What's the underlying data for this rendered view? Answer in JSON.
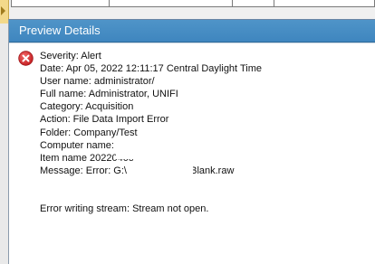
{
  "panel": {
    "title": "Preview  Details"
  },
  "details": {
    "severity": "Severity: Alert",
    "date": "Date: Apr 05, 2022 12:11:17 Central Daylight Time",
    "user_name": "User name: administrator/",
    "full_name": "Full name: Administrator, UNIFI",
    "category": "Category: Acquisition",
    "action": "Action: File Data Import Error",
    "folder": "Folder: Company/Test",
    "computer_name": "Computer name: \\",
    "item_name": "Item name  20220405_Test",
    "message": "Message: Error: G:\\",
    "message_tail": "_Blank.raw",
    "error_detail": "Error writing stream: Stream not open."
  },
  "icons": {
    "error": "error-x-icon"
  },
  "colors": {
    "header": "#4a8fc4",
    "error_red": "#d1272a"
  }
}
